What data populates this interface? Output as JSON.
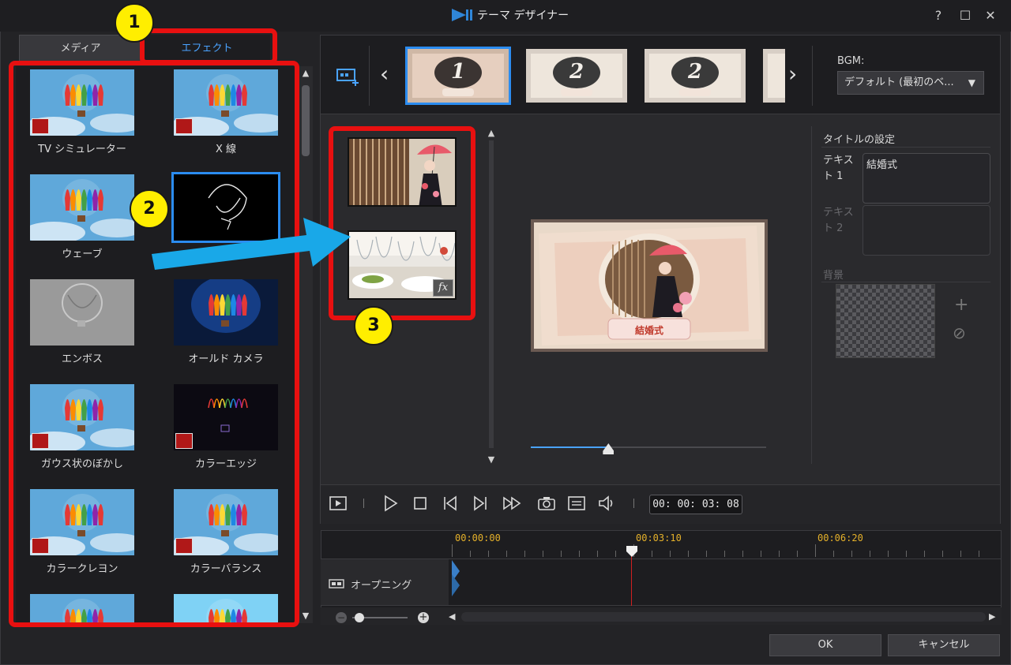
{
  "window": {
    "title": "テーマ デザイナー",
    "help": "?",
    "maximize": "☐",
    "close": "✕"
  },
  "tabs": {
    "media": "メディア",
    "effect": "エフェクト"
  },
  "effects": [
    {
      "label": "TV シミュレーター",
      "thumb": "balloon-sky",
      "badge": true
    },
    {
      "label": "X 線",
      "thumb": "balloon-sky",
      "badge": true
    },
    {
      "label": "ウェーブ",
      "thumb": "balloon-sky",
      "badge": false
    },
    {
      "label": "",
      "thumb": "balloon-outline-dark",
      "badge": false,
      "selected": true
    },
    {
      "label": "エンボス",
      "thumb": "balloon-emboss",
      "badge": false
    },
    {
      "label": "オールド カメラ",
      "thumb": "balloon-dark-glow",
      "badge": false
    },
    {
      "label": "ガウス状のぼかし",
      "thumb": "balloon-sky",
      "badge": true
    },
    {
      "label": "カラーエッジ",
      "thumb": "balloon-color-edge",
      "badge": true
    },
    {
      "label": "カラークレヨン",
      "thumb": "balloon-sky",
      "badge": true
    },
    {
      "label": "カラーバランス",
      "thumb": "balloon-sky",
      "badge": true
    },
    {
      "label": "",
      "thumb": "balloon-sky",
      "badge": false
    },
    {
      "label": "",
      "thumb": "balloon-bright",
      "badge": false
    }
  ],
  "themes": [
    {
      "num": "1",
      "selected": true
    },
    {
      "num": "2",
      "selected": false
    },
    {
      "num": "2",
      "selected": false
    },
    {
      "num": "",
      "selected": false
    }
  ],
  "bgm": {
    "label": "BGM:",
    "value": "デフォルト (最初のベ..."
  },
  "title_settings": {
    "heading": "タイトルの設定",
    "text1_label": "テキスト 1",
    "text1_value": "結婚式",
    "text2_label": "テキスト 2",
    "text2_value": "",
    "background_label": "背景"
  },
  "preview": {
    "caption": "結婚式",
    "seek_fraction": 0.33
  },
  "transport": {
    "timecode": "00: 00: 03: 08"
  },
  "timeline": {
    "marks": [
      "00:00:00",
      "00:03:10",
      "00:06:20"
    ],
    "track_name": "オープニング"
  },
  "buttons": {
    "ok": "OK",
    "cancel": "キャンセル"
  },
  "annotations": [
    "1",
    "2",
    "3"
  ],
  "colors": {
    "accent": "#2b8cf0",
    "annotation_red": "#e81010",
    "annotation_yellow": "#ffee00",
    "arrow_blue": "#19a8e8",
    "timecode_gold": "#e5b12a"
  }
}
